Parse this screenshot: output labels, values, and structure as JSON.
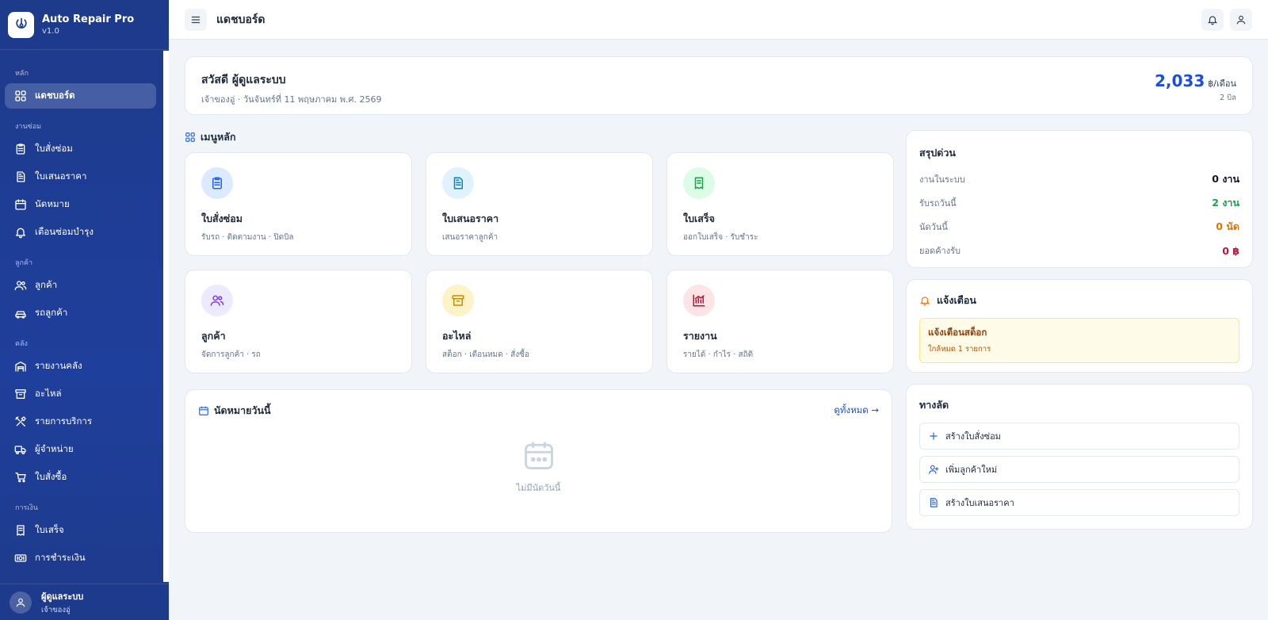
{
  "app": {
    "name": "Auto Repair Pro",
    "version": "v1.0"
  },
  "sidebar": {
    "sections": [
      {
        "title": "หลัก",
        "items": [
          {
            "label": "แดชบอร์ด",
            "icon": "grid-icon",
            "active": true
          }
        ]
      },
      {
        "title": "งานซ่อม",
        "items": [
          {
            "label": "ใบสั่งซ่อม",
            "icon": "clipboard-icon"
          },
          {
            "label": "ใบเสนอราคา",
            "icon": "document-icon"
          },
          {
            "label": "นัดหมาย",
            "icon": "calendar-icon"
          },
          {
            "label": "เตือนซ่อมบำรุง",
            "icon": "bell-icon"
          }
        ]
      },
      {
        "title": "ลูกค้า",
        "items": [
          {
            "label": "ลูกค้า",
            "icon": "users-icon"
          },
          {
            "label": "รถลูกค้า",
            "icon": "car-icon"
          }
        ]
      },
      {
        "title": "คลัง",
        "items": [
          {
            "label": "รายงานคลัง",
            "icon": "warehouse-icon"
          },
          {
            "label": "อะไหล่",
            "icon": "archive-icon"
          },
          {
            "label": "รายการบริการ",
            "icon": "tools-icon"
          },
          {
            "label": "ผู้จำหน่าย",
            "icon": "truck-icon"
          },
          {
            "label": "ใบสั่งซื้อ",
            "icon": "cart-icon"
          }
        ]
      },
      {
        "title": "การเงิน",
        "items": [
          {
            "label": "ใบเสร็จ",
            "icon": "receipt-icon"
          },
          {
            "label": "การชำระเงิน",
            "icon": "money-icon"
          }
        ]
      }
    ],
    "user": {
      "name": "ผู้ดูแลระบบ",
      "role": "เจ้าของอู่"
    }
  },
  "topbar": {
    "title": "แดชบอร์ด"
  },
  "welcome": {
    "greeting": "สวัสดี ผู้ดูแลระบบ",
    "subtitle": "เจ้าของอู่ · วันจันทร์ที่ 11 พฤษภาคม พ.ศ. 2569",
    "revenue": "2,033",
    "revenue_unit": "฿/เดือน",
    "bills": "2 บิล"
  },
  "main_menu": {
    "title": "เมนูหลัก",
    "tiles": [
      {
        "title": "ใบสั่งซ่อม",
        "sub": "รับรถ · ติดตามงาน · ปิดบิล",
        "icon": "clipboard-icon",
        "color": "#2563eb",
        "bg": "#dbeafe"
      },
      {
        "title": "ใบเสนอราคา",
        "sub": "เสนอราคาลูกค้า",
        "icon": "document-icon",
        "color": "#0284c7",
        "bg": "#e0f2fe"
      },
      {
        "title": "ใบเสร็จ",
        "sub": "ออกใบเสร็จ · รับชำระ",
        "icon": "receipt-icon",
        "color": "#16a34a",
        "bg": "#dcfce7"
      },
      {
        "title": "ลูกค้า",
        "sub": "จัดการลูกค้า · รถ",
        "icon": "users-icon",
        "color": "#7c3aed",
        "bg": "#ede9fe"
      },
      {
        "title": "อะไหล่",
        "sub": "สต็อก · เตือนหมด · สั่งซื้อ",
        "icon": "archive-icon",
        "color": "#ca8a04",
        "bg": "#fef3c7"
      },
      {
        "title": "รายงาน",
        "sub": "รายได้ · กำไร · สถิติ",
        "icon": "chart-icon",
        "color": "#be123c",
        "bg": "#ffe4e6"
      }
    ]
  },
  "appointments": {
    "title": "นัดหมายวันนี้",
    "link": "ดูทั้งหมด →",
    "empty": "ไม่มีนัดวันนี้"
  },
  "summary": {
    "title": "สรุปด่วน",
    "rows": [
      {
        "label": "งานในระบบ",
        "value": "0 งาน",
        "color": "#0f172a"
      },
      {
        "label": "รับรถวันนี้",
        "value": "2 งาน",
        "color": "#16a34a"
      },
      {
        "label": "นัดวันนี้",
        "value": "0 นัด",
        "color": "#d97706"
      },
      {
        "label": "ยอดค้างรับ",
        "value": "0 ฿",
        "color": "#be123c"
      }
    ]
  },
  "alerts": {
    "title": "แจ้งเตือน",
    "item_title": "แจ้งเตือนสต็อก",
    "item_sub": "ใกล้หมด 1 รายการ"
  },
  "shortcuts": {
    "title": "ทางลัด",
    "items": [
      {
        "label": "สร้างใบสั่งซ่อม",
        "icon": "plus-icon"
      },
      {
        "label": "เพิ่มลูกค้าใหม่",
        "icon": "user-plus-icon"
      },
      {
        "label": "สร้างใบเสนอราคา",
        "icon": "document-icon"
      }
    ]
  },
  "colors": {
    "sidebar": "#1e3a8a",
    "accent": "#1d4ed8",
    "background": "#f1f5f9"
  }
}
